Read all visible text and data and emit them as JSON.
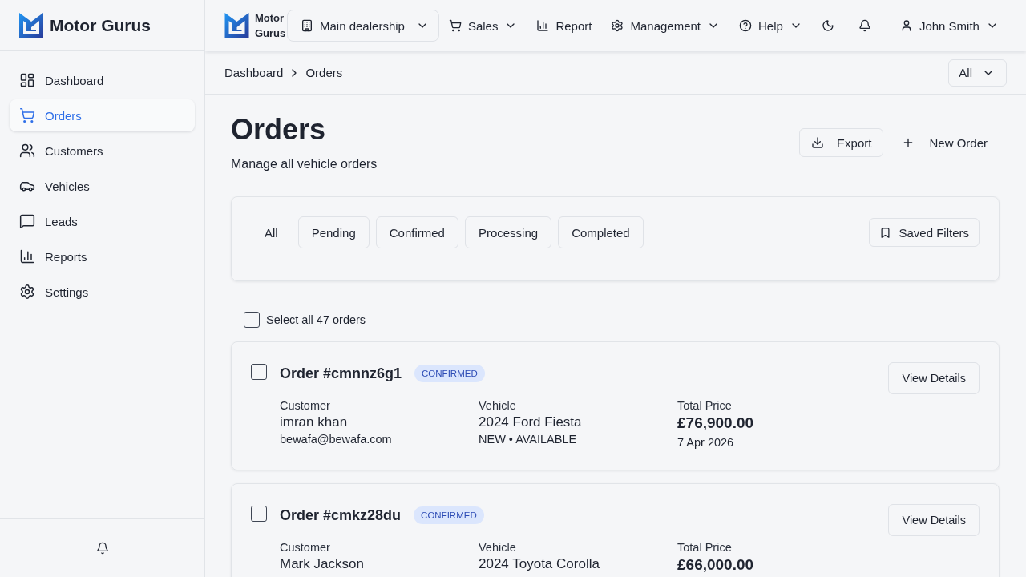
{
  "sidebar": {
    "brand": "Motor Gurus",
    "items": [
      {
        "label": "Dashboard",
        "selected": false
      },
      {
        "label": "Orders",
        "selected": true
      },
      {
        "label": "Customers",
        "selected": false
      },
      {
        "label": "Vehicles",
        "selected": false
      },
      {
        "label": "Leads",
        "selected": false
      },
      {
        "label": "Reports",
        "selected": false
      },
      {
        "label": "Settings",
        "selected": false
      }
    ]
  },
  "topbar": {
    "brand": "Motor Gurus",
    "location": "Main dealership",
    "menu": [
      {
        "label": "Sales",
        "dropdown": true
      },
      {
        "label": "Report",
        "dropdown": false
      },
      {
        "label": "Management",
        "dropdown": true
      },
      {
        "label": "Help",
        "dropdown": true
      }
    ],
    "user": "John Smith"
  },
  "breadcrumb": {
    "items": [
      "Dashboard",
      "Orders"
    ],
    "scope": "All"
  },
  "header": {
    "title": "Orders",
    "subtitle": "Manage all vehicle orders",
    "actions": [
      {
        "label": "Export",
        "kind": "export"
      },
      {
        "label": "New Order",
        "kind": "new"
      }
    ]
  },
  "filters": {
    "tabs": [
      {
        "label": "All",
        "selected": true
      },
      {
        "label": "Pending",
        "selected": false
      },
      {
        "label": "Confirmed",
        "selected": false
      },
      {
        "label": "Processing",
        "selected": false
      },
      {
        "label": "Completed",
        "selected": false
      }
    ],
    "saved": "Saved Filters"
  },
  "select_all": {
    "label": "Select all 47 orders",
    "checked": false
  },
  "orders": [
    {
      "number": "Order #cmnnz6g1",
      "status": "CONFIRMED",
      "checked": false,
      "customer": {
        "label": "Customer",
        "name": "imran khan",
        "email": "bewafa@bewafa.com"
      },
      "vehicle": {
        "label": "Vehicle",
        "name": "2024 Ford Fiesta",
        "status": "NEW • AVAILABLE"
      },
      "total": {
        "label": "Total Price",
        "amount": "£76,900.00",
        "date": "7 Apr 2026"
      },
      "action": "View Details"
    },
    {
      "number": "Order #cmkz28du",
      "status": "CONFIRMED",
      "checked": false,
      "customer": {
        "label": "Customer",
        "name": "Mark Jackson"
      },
      "vehicle": {
        "label": "Vehicle",
        "name": "2024 Toyota Corolla"
      },
      "total": {
        "label": "Total Price",
        "amount": "£66,000.00"
      },
      "action": "View Details"
    }
  ]
}
